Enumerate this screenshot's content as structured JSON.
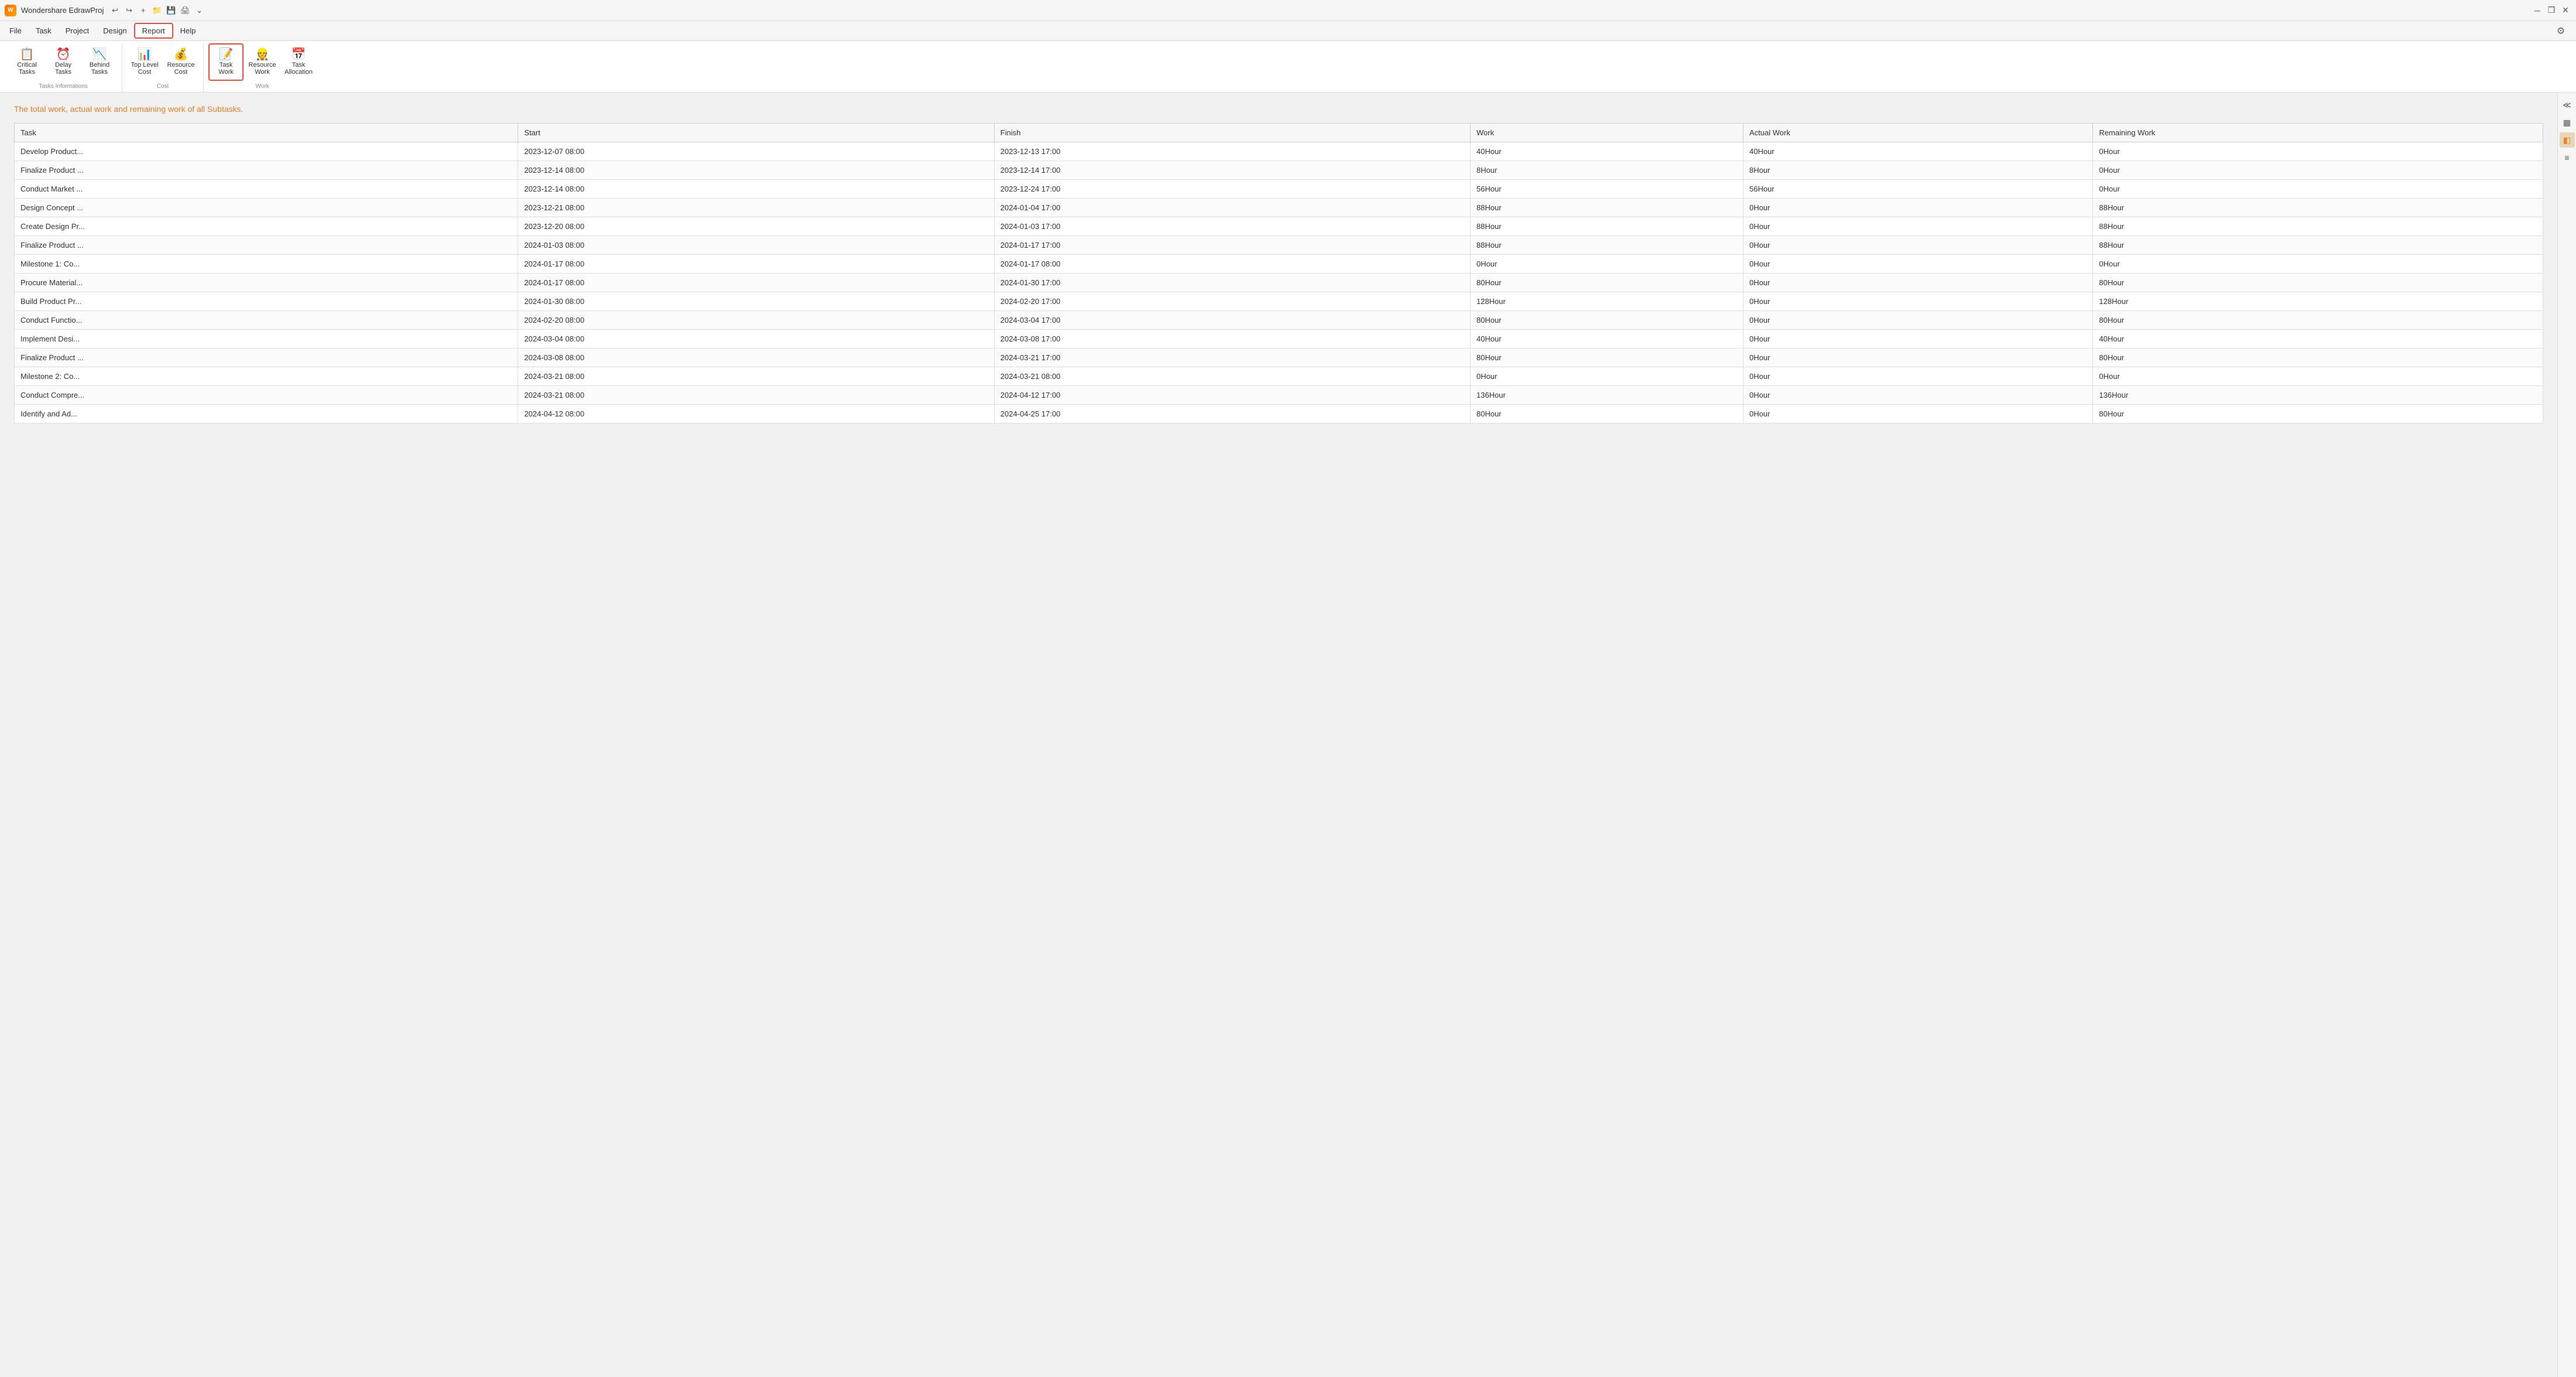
{
  "app": {
    "title": "Wondershare EdrawProj",
    "icon_label": "W"
  },
  "titlebar": {
    "undo_label": "↩",
    "redo_label": "↪",
    "new_label": "+",
    "open_label": "📁",
    "save_label": "💾",
    "print_label": "🖨",
    "more_label": "⌄",
    "minimize_label": "─",
    "restore_label": "❐",
    "close_label": "✕"
  },
  "menubar": {
    "items": [
      {
        "id": "file",
        "label": "File"
      },
      {
        "id": "task",
        "label": "Task"
      },
      {
        "id": "project",
        "label": "Project"
      },
      {
        "id": "design",
        "label": "Design"
      },
      {
        "id": "report",
        "label": "Report",
        "active": true
      },
      {
        "id": "help",
        "label": "Help"
      }
    ]
  },
  "ribbon": {
    "groups": [
      {
        "id": "tasks-informations",
        "label": "Tasks Informations",
        "buttons": [
          {
            "id": "critical-tasks",
            "label": "Critical\nTasks",
            "icon": "📋"
          },
          {
            "id": "delay-tasks",
            "label": "Delay\nTasks",
            "icon": "⏰"
          },
          {
            "id": "behind-tasks",
            "label": "Behind\nTasks",
            "icon": "📉"
          }
        ]
      },
      {
        "id": "cost",
        "label": "Cost",
        "buttons": [
          {
            "id": "top-level-cost",
            "label": "Top Level\nCost",
            "icon": "📊"
          },
          {
            "id": "resource-cost",
            "label": "Resource\nCost",
            "icon": "💰"
          }
        ]
      },
      {
        "id": "work",
        "label": "Work",
        "buttons": [
          {
            "id": "task-work",
            "label": "Task\nWork",
            "icon": "📝",
            "active": true
          },
          {
            "id": "resource-work",
            "label": "Resource\nWork",
            "icon": "👷"
          },
          {
            "id": "task-allocation",
            "label": "Task\nAllocation",
            "icon": "📅"
          }
        ]
      }
    ],
    "settings_icon": "⚙"
  },
  "main": {
    "subtitle": "The total work, actual work and remaining work of all Subtasks.",
    "table": {
      "headers": [
        "Task",
        "Start",
        "Finish",
        "Work",
        "Actual Work",
        "Remaining Work"
      ],
      "rows": [
        {
          "task": "Develop Product...",
          "start": "2023-12-07 08:00",
          "finish": "2023-12-13 17:00",
          "work": "40Hour",
          "actual_work": "40Hour",
          "remaining_work": "0Hour"
        },
        {
          "task": "Finalize Product ...",
          "start": "2023-12-14 08:00",
          "finish": "2023-12-14 17:00",
          "work": "8Hour",
          "actual_work": "8Hour",
          "remaining_work": "0Hour"
        },
        {
          "task": "Conduct Market ...",
          "start": "2023-12-14 08:00",
          "finish": "2023-12-24 17:00",
          "work": "56Hour",
          "actual_work": "56Hour",
          "remaining_work": "0Hour"
        },
        {
          "task": "Design Concept ...",
          "start": "2023-12-21 08:00",
          "finish": "2024-01-04 17:00",
          "work": "88Hour",
          "actual_work": "0Hour",
          "remaining_work": "88Hour"
        },
        {
          "task": "Create Design Pr...",
          "start": "2023-12-20 08:00",
          "finish": "2024-01-03 17:00",
          "work": "88Hour",
          "actual_work": "0Hour",
          "remaining_work": "88Hour"
        },
        {
          "task": "Finalize Product ...",
          "start": "2024-01-03 08:00",
          "finish": "2024-01-17 17:00",
          "work": "88Hour",
          "actual_work": "0Hour",
          "remaining_work": "88Hour"
        },
        {
          "task": "Milestone 1: Co...",
          "start": "2024-01-17 08:00",
          "finish": "2024-01-17 08:00",
          "work": "0Hour",
          "actual_work": "0Hour",
          "remaining_work": "0Hour"
        },
        {
          "task": "Procure Material...",
          "start": "2024-01-17 08:00",
          "finish": "2024-01-30 17:00",
          "work": "80Hour",
          "actual_work": "0Hour",
          "remaining_work": "80Hour"
        },
        {
          "task": "Build Product Pr...",
          "start": "2024-01-30 08:00",
          "finish": "2024-02-20 17:00",
          "work": "128Hour",
          "actual_work": "0Hour",
          "remaining_work": "128Hour"
        },
        {
          "task": "Conduct Functio...",
          "start": "2024-02-20 08:00",
          "finish": "2024-03-04 17:00",
          "work": "80Hour",
          "actual_work": "0Hour",
          "remaining_work": "80Hour"
        },
        {
          "task": "Implement Desi...",
          "start": "2024-03-04 08:00",
          "finish": "2024-03-08 17:00",
          "work": "40Hour",
          "actual_work": "0Hour",
          "remaining_work": "40Hour"
        },
        {
          "task": "Finalize Product ...",
          "start": "2024-03-08 08:00",
          "finish": "2024-03-21 17:00",
          "work": "80Hour",
          "actual_work": "0Hour",
          "remaining_work": "80Hour"
        },
        {
          "task": "Milestone 2: Co...",
          "start": "2024-03-21 08:00",
          "finish": "2024-03-21 08:00",
          "work": "0Hour",
          "actual_work": "0Hour",
          "remaining_work": "0Hour"
        },
        {
          "task": "Conduct Compre...",
          "start": "2024-03-21 08:00",
          "finish": "2024-04-12 17:00",
          "work": "136Hour",
          "actual_work": "0Hour",
          "remaining_work": "136Hour"
        },
        {
          "task": "Identify and Ad...",
          "start": "2024-04-12 08:00",
          "finish": "2024-04-25 17:00",
          "work": "80Hour",
          "actual_work": "0Hour",
          "remaining_work": "80Hour"
        }
      ]
    }
  },
  "right_panel": {
    "buttons": [
      {
        "id": "panel-btn-1",
        "icon": "≪"
      },
      {
        "id": "panel-btn-2",
        "icon": "▦"
      },
      {
        "id": "panel-btn-3",
        "icon": "◧",
        "active": true
      },
      {
        "id": "panel-btn-4",
        "icon": "≡"
      }
    ]
  }
}
